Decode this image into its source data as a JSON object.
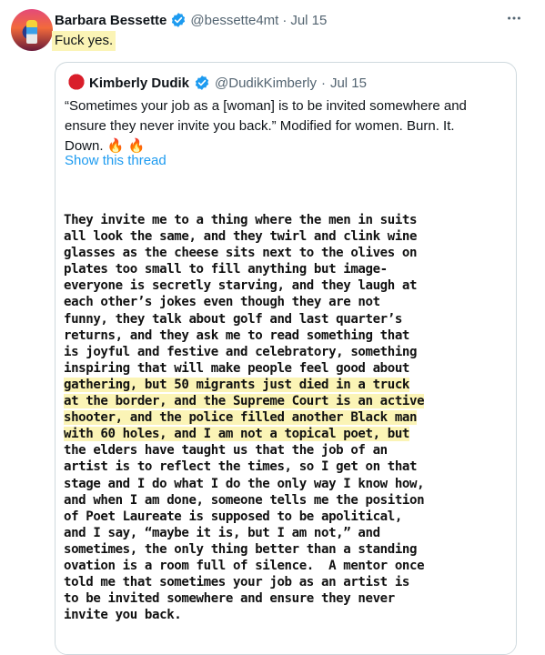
{
  "tweet": {
    "name": "Barbara Bessette",
    "handle": "@bessette4mt",
    "separator": "·",
    "date": "Jul 15",
    "text": "Fuck yes.",
    "more_icon": "more-horizontal-icon"
  },
  "quote": {
    "name": "Kimberly Dudik",
    "handle": "@DudikKimberly",
    "separator": "·",
    "date": "Jul 15",
    "text": "“Sometimes your job as a [woman] is to be invited somewhere and ensure they never invite you back.” Modified for women. Burn. It. Down. 🔥 🔥",
    "show_thread": "Show this thread"
  },
  "poem_lines": [
    "They invite me to a thing where the men in suits",
    "all look the same, and they twirl and clink wine",
    "glasses as the cheese sits next to the olives on",
    "plates too small to fill anything but image-",
    "everyone is secretly starving, and they laugh at",
    "each other’s jokes even though they are not",
    "funny, they talk about golf and last quarter’s",
    "returns, and they ask me to read something that",
    "is joyful and festive and celebratory, something",
    "inspiring that will make people feel good about",
    "gathering, but 50 migrants just died in a truck",
    "at the border, and the Supreme Court is an active",
    "shooter, and the police filled another Black man",
    "with 60 holes, and I am not a topical poet, but",
    "the elders have taught us that the job of an",
    "artist is to reflect the times, so I get on that",
    "stage and I do what I do the only way I know how,",
    "and when I am done, someone tells me the position",
    "of Poet Laureate is supposed to be apolitical,",
    "and I say, “maybe it is, but I am not,” and",
    "sometimes, the only thing better than a standing",
    "ovation is a room full of silence.  A mentor once",
    "told me that sometimes your job as an artist is",
    "to be invited somewhere and ensure they never",
    "invite you back."
  ],
  "colors": {
    "highlight": "#fbf4b6",
    "verified": "#1d9bf0",
    "link": "#1d9bf0",
    "muted": "#536471"
  }
}
